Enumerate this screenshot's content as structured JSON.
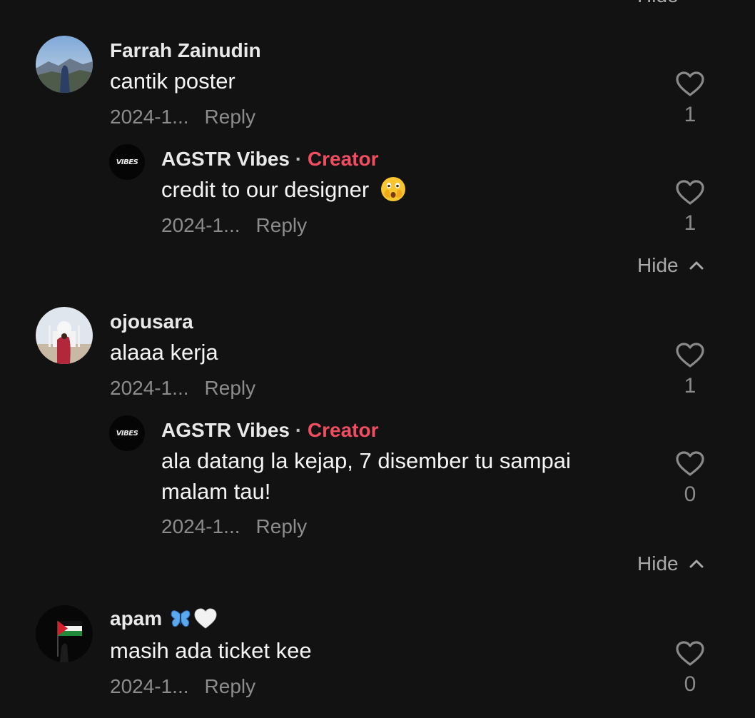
{
  "top_hide_label": "Hide",
  "comments": [
    {
      "username": "Farrah Zainudin",
      "text": "cantik poster",
      "date": "2024-1...",
      "reply_label": "Reply",
      "likes": "1",
      "reply": {
        "username": "AGSTR Vibes",
        "separator": "·",
        "badge": "Creator",
        "text": "credit to our designer",
        "date": "2024-1...",
        "reply_label": "Reply",
        "likes": "1"
      },
      "hide_label": "Hide"
    },
    {
      "username": "ojousara",
      "text": "alaaa kerja",
      "date": "2024-1...",
      "reply_label": "Reply",
      "likes": "1",
      "reply": {
        "username": "AGSTR Vibes",
        "separator": "·",
        "badge": "Creator",
        "text": "ala datang la kejap, 7 disember tu sampai malam tau!",
        "date": "2024-1...",
        "reply_label": "Reply",
        "likes": "0"
      },
      "hide_label": "Hide"
    },
    {
      "username": "apam",
      "text": "masih ada ticket kee",
      "date": "2024-1...",
      "reply_label": "Reply",
      "likes": "0"
    }
  ],
  "creator_avatar_text": "VIBES",
  "colors": {
    "background": "#121212",
    "creator_badge": "#f04e60",
    "muted": "#8c8c8c"
  },
  "icons": [
    "heart-icon",
    "chevron-up-icon",
    "face-with-open-eyes-and-hand-over-mouth-emoji",
    "blue-butterfly-emoji",
    "white-heart-emoji"
  ]
}
